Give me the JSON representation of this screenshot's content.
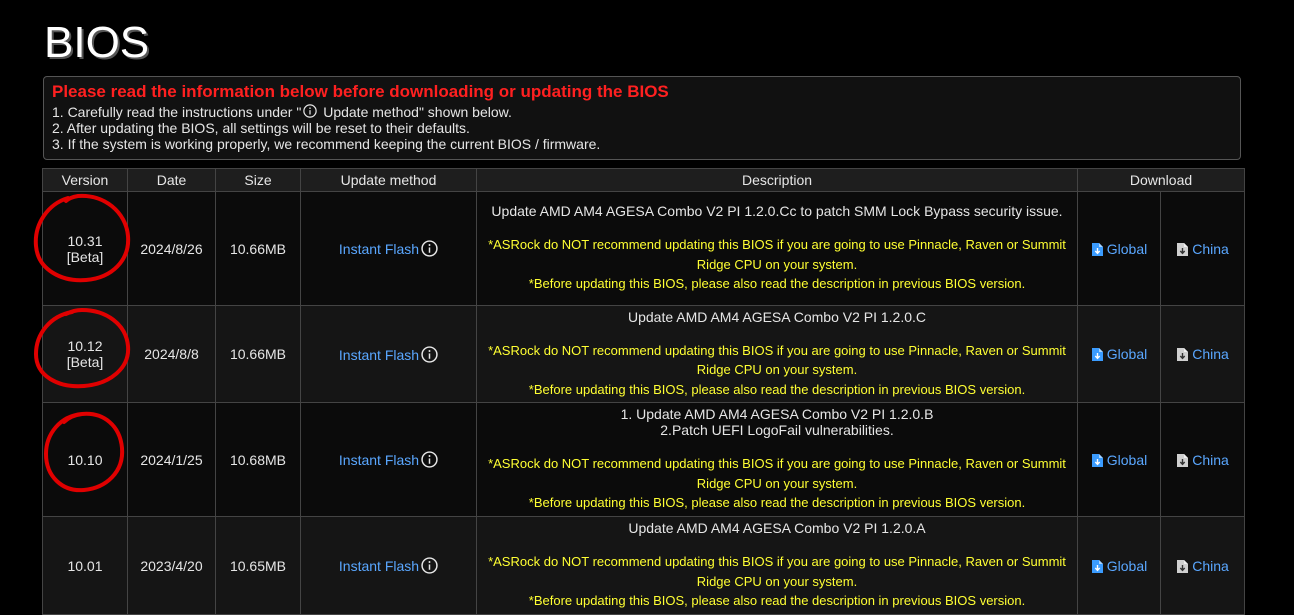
{
  "title": "BIOS",
  "notice": {
    "heading": "Please read the information below before downloading or updating the BIOS",
    "line1_pre": "1. Carefully read the instructions under \"",
    "line1_post": " Update method\" shown below.",
    "line2": "2. After updating the BIOS, all settings will be reset to their defaults.",
    "line3": "3. If the system is working properly, we recommend keeping the current BIOS / firmware."
  },
  "table": {
    "headers": [
      "Version",
      "Date",
      "Size",
      "Update method",
      "Description",
      "Download"
    ],
    "rows": [
      {
        "version": "10.31",
        "tag": "[Beta]",
        "date": "2024/8/26",
        "size": "10.66MB",
        "method": "Instant Flash",
        "desc_main": "Update AMD AM4 AGESA Combo V2 PI 1.2.0.Cc to patch SMM Lock Bypass security issue.",
        "warn1": "*ASRock do NOT recommend updating this BIOS if you are going to use Pinnacle, Raven or Summit Ridge CPU on your system.",
        "warn2": "*Before updating this BIOS, please also read the description in previous BIOS version.",
        "dl_global": "Global",
        "dl_china": "China"
      },
      {
        "version": "10.12",
        "tag": "[Beta]",
        "date": "2024/8/8",
        "size": "10.66MB",
        "method": "Instant Flash",
        "desc_main": "Update AMD AM4 AGESA Combo V2 PI 1.2.0.C",
        "warn1": "*ASRock do NOT recommend updating this BIOS if you are going to use Pinnacle, Raven or Summit Ridge CPU on your system.",
        "warn2": "*Before updating this BIOS, please also read the description in previous BIOS version.",
        "dl_global": "Global",
        "dl_china": "China"
      },
      {
        "version": "10.10",
        "tag": "",
        "date": "2024/1/25",
        "size": "10.68MB",
        "method": "Instant Flash",
        "desc_line1": "1. Update AMD AM4 AGESA Combo V2 PI 1.2.0.B",
        "desc_line2": "2.Patch UEFI LogoFail vulnerabilities.",
        "warn1": "*ASRock do NOT recommend updating this BIOS if you are going to use Pinnacle, Raven or Summit Ridge CPU on your system.",
        "warn2": "*Before updating this BIOS, please also read the description in previous BIOS version.",
        "dl_global": "Global",
        "dl_china": "China"
      },
      {
        "version": "10.01",
        "tag": "",
        "date": "2023/4/20",
        "size": "10.65MB",
        "method": "Instant Flash",
        "desc_main": "Update AMD AM4 AGESA Combo V2 PI 1.2.0.A",
        "warn1": "*ASRock do NOT recommend updating this BIOS if you are going to use Pinnacle, Raven or Summit Ridge CPU on your system.",
        "warn2": "*Before updating this BIOS, please also read the description in previous BIOS version.",
        "dl_global": "Global",
        "dl_china": "China"
      }
    ]
  },
  "colors": {
    "background": "#000000",
    "heading_red": "#ff2020",
    "warning_yellow": "#ffff33",
    "link_blue": "#5aa7ff",
    "annotation_red": "#e00000"
  },
  "icons": {
    "info": "info-circle-icon",
    "download": "download-file-icon"
  }
}
